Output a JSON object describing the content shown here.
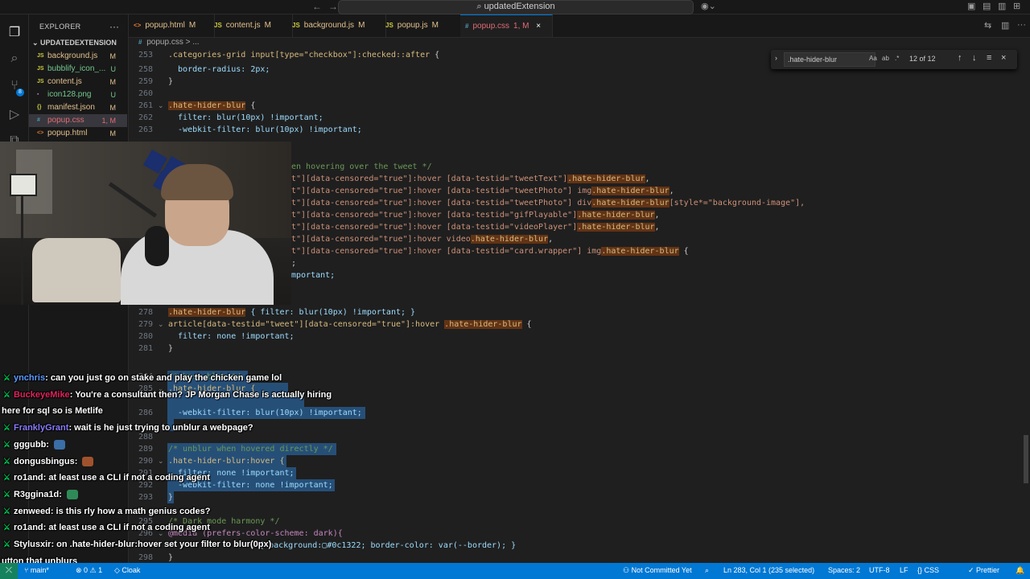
{
  "titlebar": {
    "search": "updatedExtension",
    "back": "←",
    "forward": "→"
  },
  "sidebar": {
    "title": "EXPLORER",
    "more": "···",
    "folder": "UPDATEDEXTENSION",
    "files": [
      {
        "icon": "JS",
        "name": "background.js",
        "status": "M",
        "type": "js"
      },
      {
        "icon": "JS",
        "name": "bubblify_icon_...",
        "status": "U",
        "type": "js"
      },
      {
        "icon": "JS",
        "name": "content.js",
        "status": "M",
        "type": "js"
      },
      {
        "icon": "▪",
        "name": "icon128.png",
        "status": "U",
        "type": "png"
      },
      {
        "icon": "{}",
        "name": "manifest.json",
        "status": "M",
        "type": "json"
      },
      {
        "icon": "#",
        "name": "popup.css",
        "status": "1, M",
        "type": "css"
      },
      {
        "icon": "<>",
        "name": "popup.html",
        "status": "M",
        "type": "html"
      }
    ]
  },
  "activity": {
    "badge": "8"
  },
  "tabs": [
    {
      "icon": "<>",
      "label": "popup.html",
      "status": "M",
      "type": "html"
    },
    {
      "icon": "JS",
      "label": "content.js",
      "status": "M",
      "type": "js"
    },
    {
      "icon": "JS",
      "label": "background.js",
      "status": "M",
      "type": "js"
    },
    {
      "icon": "JS",
      "label": "popup.js",
      "status": "M",
      "type": "js"
    },
    {
      "icon": "#",
      "label": "popup.css",
      "status": "1, M",
      "type": "css",
      "active": true
    }
  ],
  "breadcrumb": {
    "icon": "#",
    "file": "popup.css",
    "more": "> ..."
  },
  "find": {
    "value": ".hate-hider-blur",
    "case": "Aa",
    "word": "ab",
    "regex": ".*",
    "count": "12 of 12"
  },
  "editor": {
    "lines": [
      {
        "n": "253",
        "fold": ""
      },
      {
        "n": "258",
        "fold": ""
      },
      {
        "n": "259",
        "fold": ""
      },
      {
        "n": "260",
        "fold": ""
      },
      {
        "n": "261",
        "fold": "⌄"
      },
      {
        "n": "262",
        "fold": ""
      },
      {
        "n": "263",
        "fold": ""
      },
      {
        "n": "278",
        "fold": ""
      },
      {
        "n": "279",
        "fold": "⌄"
      },
      {
        "n": "280",
        "fold": ""
      },
      {
        "n": "281",
        "fold": ""
      },
      {
        "n": "284",
        "fold": ""
      },
      {
        "n": "285",
        "fold": "⌄"
      },
      {
        "n": "286",
        "fold": ""
      },
      {
        "n": "288",
        "fold": ""
      },
      {
        "n": "289",
        "fold": ""
      },
      {
        "n": "290",
        "fold": "⌄"
      },
      {
        "n": "291",
        "fold": ""
      },
      {
        "n": "292",
        "fold": ""
      },
      {
        "n": "293",
        "fold": ""
      },
      {
        "n": "295",
        "fold": ""
      },
      {
        "n": "296",
        "fold": "⌄"
      },
      {
        "n": "298",
        "fold": ""
      }
    ],
    "code": {
      "l253a": ".categories-grid input[type=\"checkbox\"]:checked::after",
      "l253b": " {",
      "l258": "  border-radius: 2px;",
      "l259": "}",
      "l261a": ".hate-hider-blur",
      "l261b": " {",
      "l262": "  filter: blur(10px) !important;",
      "l263": "  -webkit-filter: blur(10px) !important;",
      "c1": "en hovering over the tweet */",
      "c2a": "t\"][data-censored=\"true\"]:hover [data-testid=\"tweetText\"]",
      "c2b": ".hate-hider-blur",
      "c2c": ",",
      "c3a": "t\"][data-censored=\"true\"]:hover [data-testid=\"tweetPhoto\"] img",
      "c3b": ".hate-hider-blur",
      "c3c": ",",
      "c4a": "t\"][data-censored=\"true\"]:hover [data-testid=\"tweetPhoto\"] div",
      "c4b": ".hate-hider-blur",
      "c4c": "[style*=\"background-image\"],",
      "c5a": "t\"][data-censored=\"true\"]:hover [data-testid=\"gifPlayable\"]",
      "c5b": ".hate-hider-blur",
      "c5c": ",",
      "c6a": "t\"][data-censored=\"true\"]:hover [data-testid=\"videoPlayer\"]",
      "c6b": ".hate-hider-blur",
      "c6c": ",",
      "c7a": "t\"][data-censored=\"true\"]:hover video",
      "c7b": ".hate-hider-blur",
      "c7c": ",",
      "c8a": "t\"][data-censored=\"true\"]:hover [data-testid=\"card.wrapper\"] img",
      "c8b": ".hate-hider-blur",
      "c8c": " {",
      "c9": ";",
      "c10": "mportant;",
      "l278a": ".hate-hider-blur",
      "l278b": " { filter: blur(10px) !important; }",
      "l279a": "article[data-testid=\"tweet\"][data-censored=\"true\"]:hover ",
      "l279b": ".hate-hider-blur",
      "l279c": " {",
      "l280": "  filter: none !important;",
      "l281": "}",
      "l284": "/* base blur */",
      "l285": ".hate-hider-blur {",
      "l286": "  -webkit-filter: blur(10px) !important;",
      "l289": "/* unblur when hovered directly */",
      "l290": ".hate-hider-blur:hover {",
      "l291": "  filter: none !important;",
      "l292": "  -webkit-filter: none !important;",
      "l293": "}",
      "l295": "/* Dark mode harmony */",
      "l296": "@media (prefers-color-scheme: dark){",
      "l297": "l { background:▢#0c1322; border-color: var(--border); }",
      "l298": "}"
    }
  },
  "chat": [
    {
      "user": "ynchris",
      "color": "#5b9bff",
      "text": ": can you just go on stake and play the chicken game lol"
    },
    {
      "user": "BuckeyeMike",
      "color": "#e0245e",
      "text": ": You're a consultant then? JP Morgan Chase is actually hiring"
    },
    {
      "user": "",
      "color": "#ffffff",
      "text": "here for sql so is Metlife"
    },
    {
      "user": "FranklyGrant",
      "color": "#8a7bff",
      "text": ": wait is he just trying to unblur a webpage?"
    },
    {
      "user": "gggubb",
      "color": "#ffffff",
      "text": ":"
    },
    {
      "user": "dongusbingus",
      "color": "#ffffff",
      "text": ":"
    },
    {
      "user": "ro1and",
      "color": "#ffffff",
      "text": ": at least use a CLI if not a coding agent"
    },
    {
      "user": "R3ggina1d",
      "color": "#ffffff",
      "text": ":"
    },
    {
      "user": "zenweed",
      "color": "#ffffff",
      "text": ": is this rly how a math genius codes?"
    },
    {
      "user": "ro1and",
      "color": "#ffffff",
      "text": ": at least use a CLI if not a coding agent"
    },
    {
      "user": "Stylusxir",
      "color": "#ffffff",
      "text": ": on .hate-hider-blur:hover set your filter to blur(0px)"
    },
    {
      "user": "",
      "color": "#ffffff",
      "text": "utton that unblurs"
    }
  ],
  "statusbar": {
    "branch": "main*",
    "sync": "⊗ 0 ⚠ 1",
    "cloak": "Cloak",
    "commit": "Not Committed Yet",
    "position": "Ln 283, Col 1 (235 selected)",
    "spaces": "Spaces: 2",
    "encoding": "UTF-8",
    "eol": "LF",
    "language": "CSS",
    "prettier": "Prettier"
  },
  "colors": {
    "accent": "#0078d4",
    "status": "#0078d4",
    "selection": "#264f78",
    "find_hl": "#623315"
  }
}
